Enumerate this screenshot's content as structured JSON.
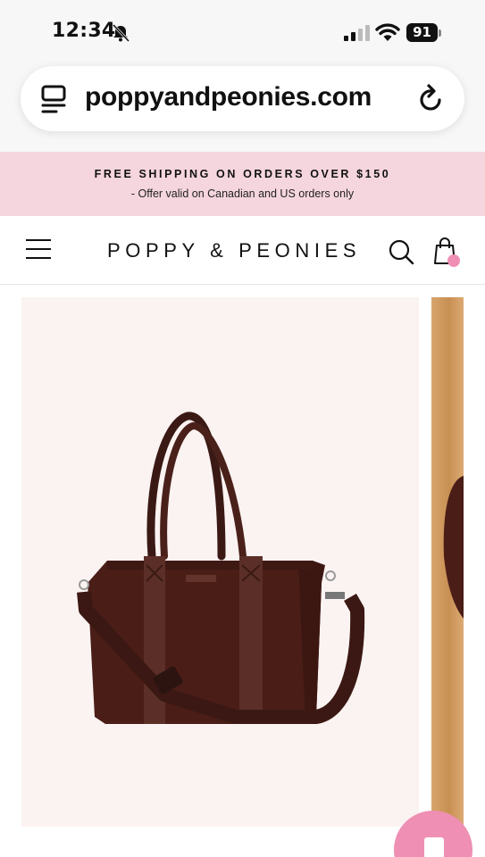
{
  "status_bar": {
    "time": "12:34",
    "battery": "91"
  },
  "browser": {
    "url": "poppyandpeonies.com"
  },
  "promo": {
    "title": "FREE SHIPPING ON ORDERS OVER $150",
    "subtitle": "- Offer valid on Canadian and US orders only"
  },
  "header": {
    "brand": "POPPY & PEONIES"
  },
  "colors": {
    "promo_bg": "#f6d6de",
    "accent_pink": "#ee8fb3",
    "bag_brown": "#4a1d17"
  },
  "icons": [
    "bell-slash-icon",
    "signal-icon",
    "wifi-icon",
    "battery-icon",
    "reader-icon",
    "reload-icon",
    "menu-icon",
    "search-icon",
    "cart-icon",
    "chat-icon"
  ]
}
